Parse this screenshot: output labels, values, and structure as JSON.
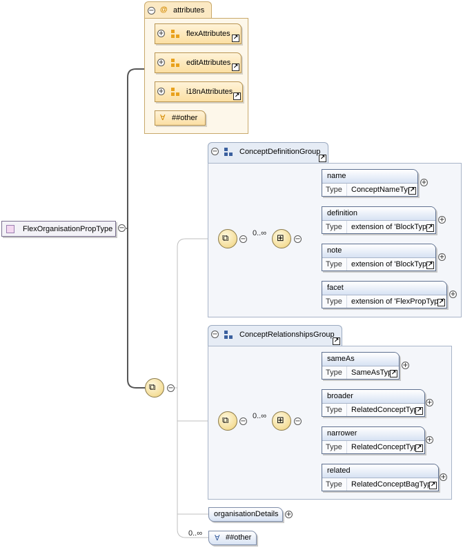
{
  "root": {
    "label": "FlexOrganisationPropType"
  },
  "attributes": {
    "label": "attributes",
    "at_symbol": "@",
    "groups": [
      {
        "label": "flexAttributes"
      },
      {
        "label": "editAttributes"
      },
      {
        "label": "i18nAttributes"
      }
    ],
    "any_label": "##other",
    "any_symbol": "∀"
  },
  "concept_definition_group": {
    "label": "ConceptDefinitionGroup",
    "multiplicity": "0..∞",
    "elements": [
      {
        "name": "name",
        "type_key": "Type",
        "type": "ConceptNameType"
      },
      {
        "name": "definition",
        "type_key": "Type",
        "type": "extension of 'BlockType'"
      },
      {
        "name": "note",
        "type_key": "Type",
        "type": "extension of 'BlockType'"
      },
      {
        "name": "facet",
        "type_key": "Type",
        "type": "extension of 'FlexPropType'"
      }
    ]
  },
  "concept_relationships_group": {
    "label": "ConceptRelationshipsGroup",
    "multiplicity": "0..∞",
    "elements": [
      {
        "name": "sameAs",
        "type_key": "Type",
        "type": "SameAsType"
      },
      {
        "name": "broader",
        "type_key": "Type",
        "type": "RelatedConceptType"
      },
      {
        "name": "narrower",
        "type_key": "Type",
        "type": "RelatedConceptType"
      },
      {
        "name": "related",
        "type_key": "Type",
        "type": "RelatedConceptBagType"
      }
    ]
  },
  "organisation_details": {
    "label": "organisationDetails"
  },
  "any_other": {
    "multiplicity": "0..∞",
    "label": "##other",
    "symbol": "∀"
  },
  "symbols": {
    "expand": "+",
    "collapse": "−",
    "link": "↗"
  },
  "colors": {
    "attribute_fill": "#fbe9c4",
    "group_fill": "#f4f6fa",
    "element_header": "#d7e2f3",
    "connector": "#555555"
  }
}
